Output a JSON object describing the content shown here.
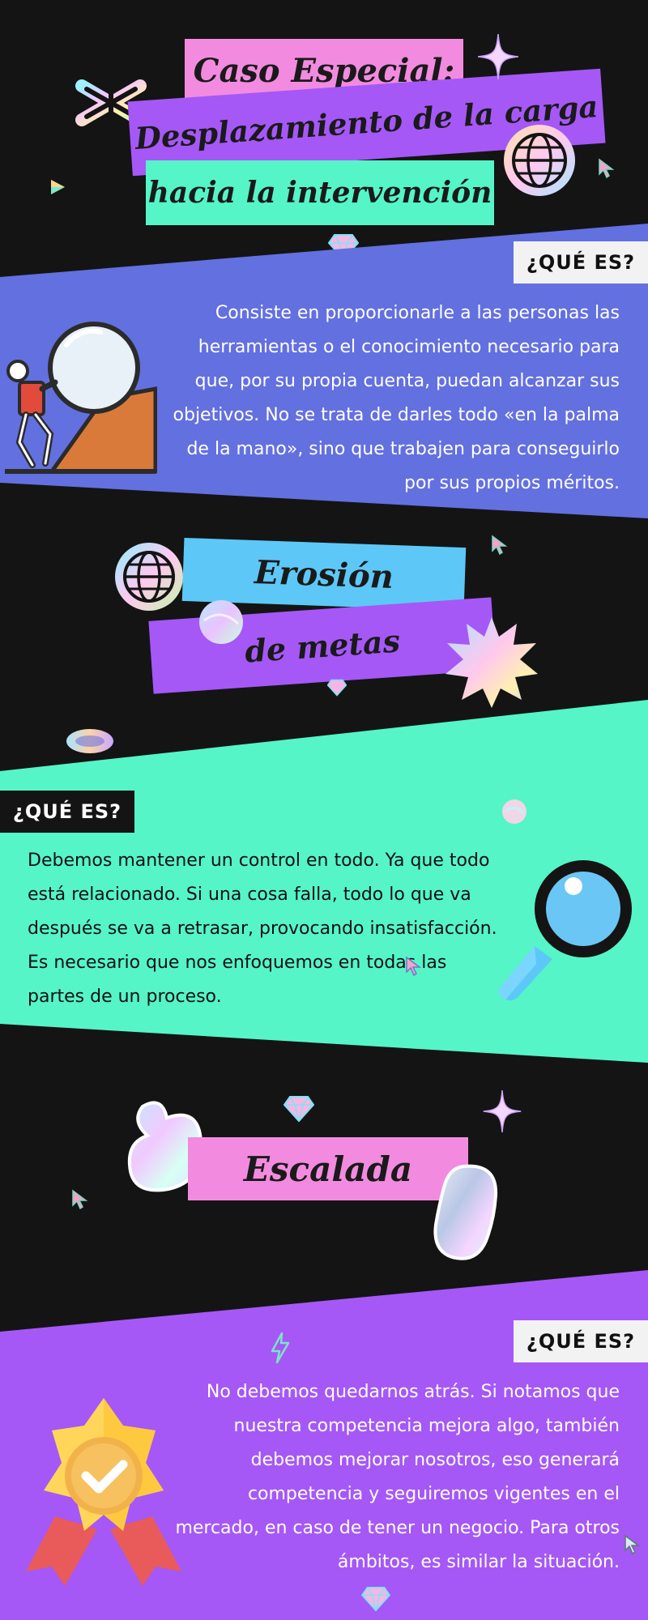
{
  "header": {
    "title_line1": "Caso Especial:",
    "title_line2": "Desplazamiento de la carga",
    "title_line3": "hacia la intervención"
  },
  "sections": [
    {
      "heading": "",
      "label": "¿QUÉ ES?",
      "text": "Consiste en proporcionarle a las personas las herramientas o el conocimiento necesario para que, por su propia cuenta, puedan alcanzar sus objetivos. No se trata de darles todo «en la palma de la mano», sino que trabajen para conseguirlo por sus propios méritos."
    },
    {
      "heading_line1": "Erosión",
      "heading_line2": "de metas",
      "label": "¿QUÉ ES?",
      "text": "Debemos mantener un control en todo. Ya que todo está relacionado. Si una cosa falla, todo lo que va después se va a retrasar, provocando insatisfacción. Es necesario que nos enfoquemos en todas las partes de un proceso."
    },
    {
      "heading": "Escalada",
      "label": "¿QUÉ ES?",
      "text": "No debemos quedarnos atrás. Si notamos que nuestra competencia mejora algo, también debemos mejorar nosotros, eso generará competencia y seguiremos vigentes en el mercado, en caso de tener un negocio. Para otros ámbitos, es similar la situación."
    }
  ],
  "icons": [
    "asterisk-icon",
    "sparkle-icon",
    "globe-icon",
    "cursor-icon",
    "play-icon",
    "diamond-icon",
    "climber-boulder-icon",
    "starburst-icon",
    "ring-icon",
    "magnifier-icon",
    "blob-icon",
    "lightning-icon",
    "medal-icon"
  ],
  "colors": {
    "background": "#141414",
    "pink": "#f28be0",
    "purple": "#a558f6",
    "mint": "#55f5c8",
    "indigo": "#6370e0",
    "sky": "#5dc8f7",
    "text_light": "#ffffff",
    "text_dark": "#111111"
  }
}
